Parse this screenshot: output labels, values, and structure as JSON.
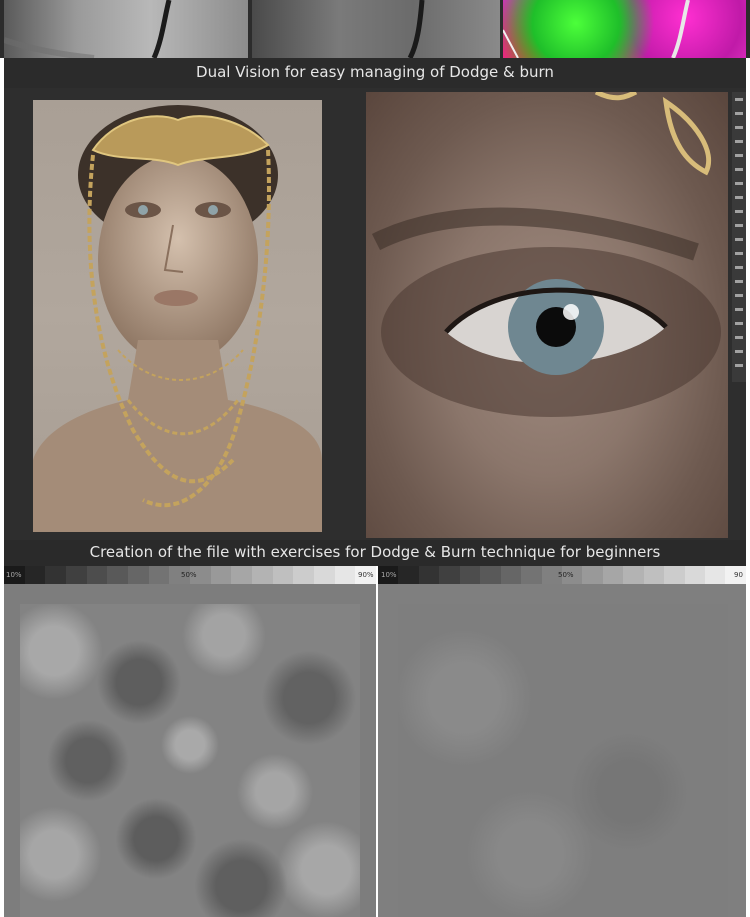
{
  "top_strip": {
    "thumbnails": [
      {
        "name": "grayscale-shoulder-view"
      },
      {
        "name": "high-contrast-gray-view"
      },
      {
        "name": "false-color-solarized-view"
      }
    ]
  },
  "captions": {
    "dual_vision": "Dual Vision for easy managing of Dodge & burn",
    "exercise_file": "Creation of the file with exercises for Dodge & Burn technique for beginners"
  },
  "gray_ramps": [
    {
      "left_label": "10%",
      "mid_label": "50%",
      "right_label": "90%"
    },
    {
      "left_label": "10%",
      "mid_label": "50%",
      "right_label": "90"
    }
  ],
  "colors": {
    "panel_background": "#2c2c2c",
    "caption_bar": "#2a2a2a",
    "caption_text": "#e6e6e6",
    "lower_panel": "#7f7f7f"
  }
}
